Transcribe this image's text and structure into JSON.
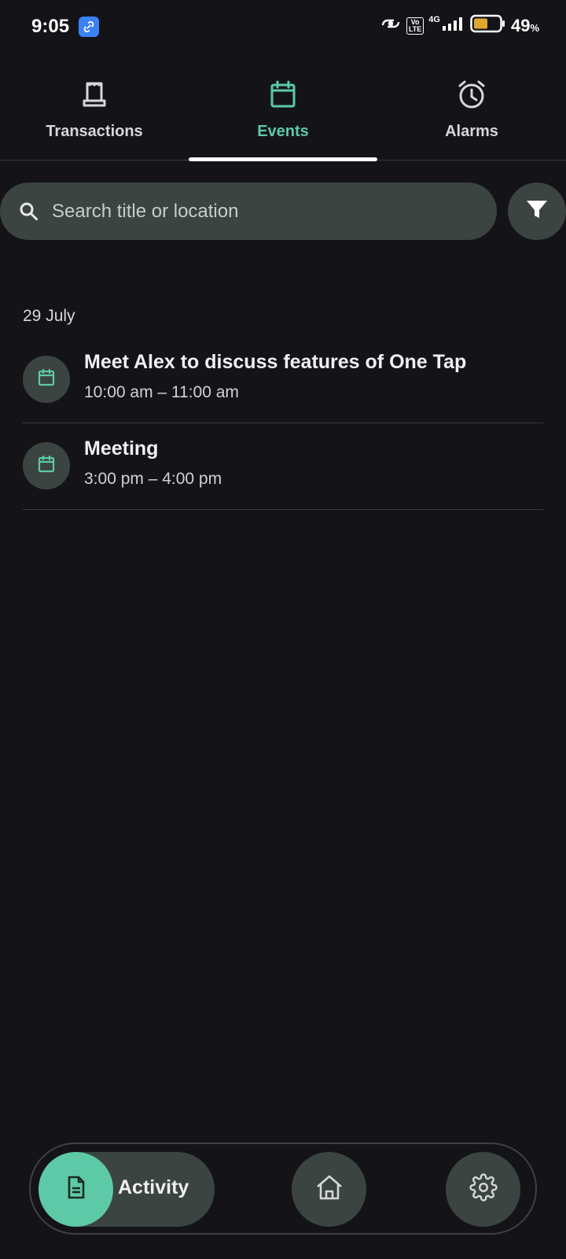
{
  "status_bar": {
    "time": "9:05",
    "network": "4G",
    "volte": "Vo LTE",
    "battery_percent": "49",
    "battery_unit": "%",
    "battery_color": "#e0a82e"
  },
  "tabs": [
    {
      "label": "Transactions",
      "icon": "receipt-icon",
      "active": false
    },
    {
      "label": "Events",
      "icon": "calendar-icon",
      "active": true
    },
    {
      "label": "Alarms",
      "icon": "alarm-clock-icon",
      "active": false
    }
  ],
  "search": {
    "placeholder": "Search title or location",
    "value": ""
  },
  "events": {
    "date_header": "29 July",
    "items": [
      {
        "title": "Meet Alex to discuss features of One Tap",
        "time": "10:00 am – 11:00 am",
        "icon": "calendar-icon"
      },
      {
        "title": "Meeting",
        "time": "3:00 pm – 4:00 pm",
        "icon": "calendar-icon"
      }
    ]
  },
  "bottom_nav": {
    "activity_label": "Activity",
    "items": [
      "document-icon",
      "home-icon",
      "gear-icon"
    ]
  },
  "colors": {
    "accent": "#5ec9a6",
    "background": "#141418",
    "surface": "#3b4440"
  }
}
